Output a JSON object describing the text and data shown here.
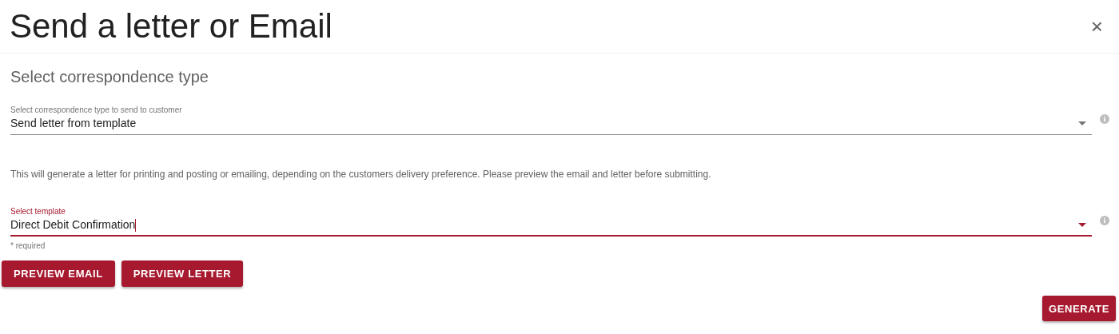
{
  "dialog": {
    "title": "Send a letter or Email",
    "close": "×"
  },
  "section_title": "Select correspondence type",
  "fields": [
    {
      "label": "Select correspondence type to send to customer",
      "value": "Send letter from template",
      "focused": false
    },
    {
      "label": "Select template",
      "value": "Direct Debit Confirmation",
      "focused": true,
      "hint": "* required"
    }
  ],
  "description": "This will generate a letter for printing and posting or emailing, depending on the customers delivery preference. Please preview the email and letter before submitting.",
  "buttons": [
    "PREVIEW EMAIL",
    "PREVIEW LETTER"
  ],
  "footer_button": "GENERATE"
}
